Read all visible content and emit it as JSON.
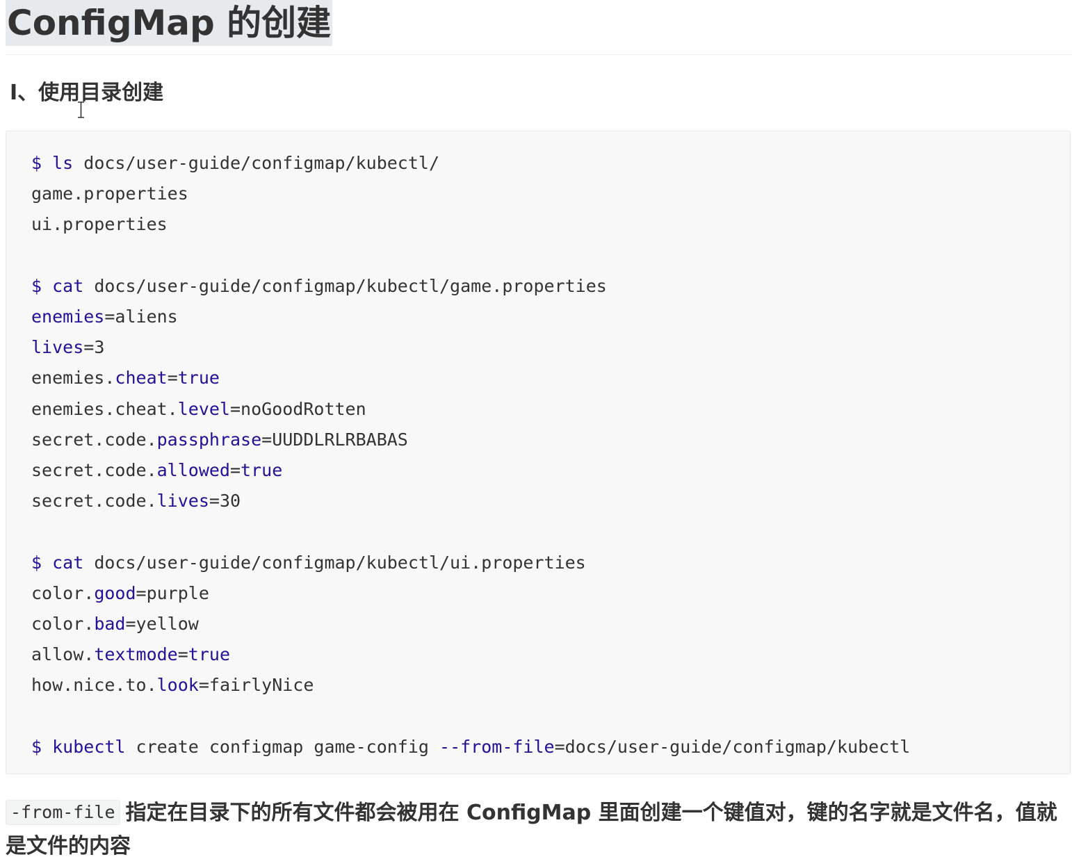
{
  "title": "ConfigMap 的创建",
  "subheading": "I、使用目录创建",
  "code": {
    "lines": [
      [
        {
          "t": "$ ",
          "c": "kw"
        },
        {
          "t": "ls",
          "c": "kw"
        },
        {
          "t": " docs/user-guide/configmap/kubectl/",
          "c": "plain"
        }
      ],
      [
        {
          "t": "game.properties",
          "c": "plain"
        }
      ],
      [
        {
          "t": "ui.properties",
          "c": "plain"
        }
      ],
      [],
      [
        {
          "t": "$ ",
          "c": "kw"
        },
        {
          "t": "cat",
          "c": "kw"
        },
        {
          "t": " docs/user-guide/configmap/kubectl/game.properties",
          "c": "plain"
        }
      ],
      [
        {
          "t": "enemies",
          "c": "kw"
        },
        {
          "t": "=",
          "c": "plain"
        },
        {
          "t": "aliens",
          "c": "plain"
        }
      ],
      [
        {
          "t": "lives",
          "c": "kw"
        },
        {
          "t": "=3",
          "c": "plain"
        }
      ],
      [
        {
          "t": "enemies.",
          "c": "plain"
        },
        {
          "t": "cheat",
          "c": "kw"
        },
        {
          "t": "=",
          "c": "plain"
        },
        {
          "t": "true",
          "c": "kw"
        }
      ],
      [
        {
          "t": "enemies.cheat.",
          "c": "plain"
        },
        {
          "t": "level",
          "c": "kw"
        },
        {
          "t": "=noGoodRotten",
          "c": "plain"
        }
      ],
      [
        {
          "t": "secret.code.",
          "c": "plain"
        },
        {
          "t": "passphrase",
          "c": "kw"
        },
        {
          "t": "=UUDDLRLRBABAS",
          "c": "plain"
        }
      ],
      [
        {
          "t": "secret.code.",
          "c": "plain"
        },
        {
          "t": "allowed",
          "c": "kw"
        },
        {
          "t": "=",
          "c": "plain"
        },
        {
          "t": "true",
          "c": "kw"
        }
      ],
      [
        {
          "t": "secret.code.",
          "c": "plain"
        },
        {
          "t": "lives",
          "c": "kw"
        },
        {
          "t": "=30",
          "c": "plain"
        }
      ],
      [],
      [
        {
          "t": "$ ",
          "c": "kw"
        },
        {
          "t": "cat",
          "c": "kw"
        },
        {
          "t": " docs/user-guide/configmap/kubectl/ui.properties",
          "c": "plain"
        }
      ],
      [
        {
          "t": "color.",
          "c": "plain"
        },
        {
          "t": "good",
          "c": "kw"
        },
        {
          "t": "=purple",
          "c": "plain"
        }
      ],
      [
        {
          "t": "color.",
          "c": "plain"
        },
        {
          "t": "bad",
          "c": "kw"
        },
        {
          "t": "=yellow",
          "c": "plain"
        }
      ],
      [
        {
          "t": "allow.",
          "c": "plain"
        },
        {
          "t": "textmode",
          "c": "kw"
        },
        {
          "t": "=",
          "c": "plain"
        },
        {
          "t": "true",
          "c": "kw"
        }
      ],
      [
        {
          "t": "how.nice.to.",
          "c": "plain"
        },
        {
          "t": "look",
          "c": "kw"
        },
        {
          "t": "=fairlyNice",
          "c": "plain"
        }
      ],
      [],
      [
        {
          "t": "$ ",
          "c": "kw"
        },
        {
          "t": "kubectl",
          "c": "kw"
        },
        {
          "t": " create configmap game-config ",
          "c": "plain"
        },
        {
          "t": "--from-file",
          "c": "kw"
        },
        {
          "t": "=docs/user-guide/configmap/kubectl",
          "c": "plain"
        }
      ]
    ]
  },
  "paragraph": {
    "inline_code": "-from-file",
    "text": "指定在目录下的所有文件都会被用在 ConfigMap 里面创建一个键值对，键的名字就是文件名，值就是文件的内容"
  },
  "colors": {
    "keyword": "#221199",
    "text": "#333333",
    "code_background": "#f8f8f8",
    "title_highlight": "#e7eaed"
  }
}
